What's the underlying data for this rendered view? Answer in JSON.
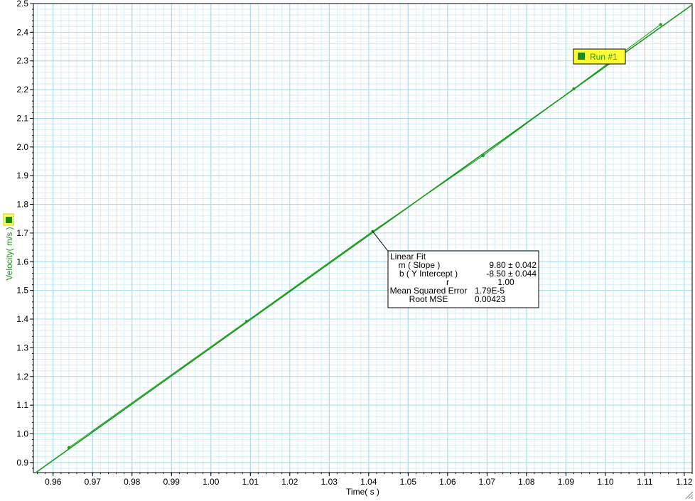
{
  "chart_data": {
    "type": "line",
    "title": "",
    "xlabel": "Time( s )",
    "ylabel": "Velocity( m/s )",
    "xlim": [
      0.955,
      1.122
    ],
    "ylim": [
      0.865,
      2.5
    ],
    "x_ticks": [
      "0.96",
      "0.97",
      "0.98",
      "0.99",
      "1.00",
      "1.01",
      "1.02",
      "1.03",
      "1.04",
      "1.05",
      "1.06",
      "1.07",
      "1.08",
      "1.09",
      "1.10",
      "1.11",
      "1.12"
    ],
    "y_ticks": [
      "0.9",
      "1.0",
      "1.1",
      "1.2",
      "1.3",
      "1.4",
      "1.5",
      "1.6",
      "1.7",
      "1.8",
      "1.9",
      "2.0",
      "2.1",
      "2.2",
      "2.3",
      "2.4",
      "2.5"
    ],
    "grid": true,
    "series": [
      {
        "name": "Run #1",
        "color": "#1a9a1a",
        "x": [
          0.964,
          1.009,
          1.041,
          1.069,
          1.092,
          1.114
        ],
        "y": [
          0.952,
          1.392,
          1.706,
          1.97,
          2.203,
          2.427
        ]
      }
    ],
    "linear_fit": {
      "slope": 9.8,
      "intercept": -8.5,
      "title": "Linear Fit",
      "rows": [
        {
          "label": "m ( Slope )",
          "value": "9.80 ± 0.042"
        },
        {
          "label": "b ( Y Intercept )",
          "value": "-8.50 ± 0.044"
        },
        {
          "label": "r",
          "value": "1.00"
        },
        {
          "label": "Mean Squared Error",
          "value": "1.79E-5"
        },
        {
          "label": "Root MSE",
          "value": "0.00423"
        }
      ],
      "anchor_x": 1.041,
      "anchor_y": 1.706
    },
    "legend": {
      "label": "Run #1",
      "placement": "top-right"
    },
    "colors": {
      "series": "#1a9a1a",
      "grid_major": "#a8dcec",
      "grid_minor": "#d6eef7",
      "legend_bg": "#ffff33",
      "axis_text": "#1a9a1a"
    }
  }
}
